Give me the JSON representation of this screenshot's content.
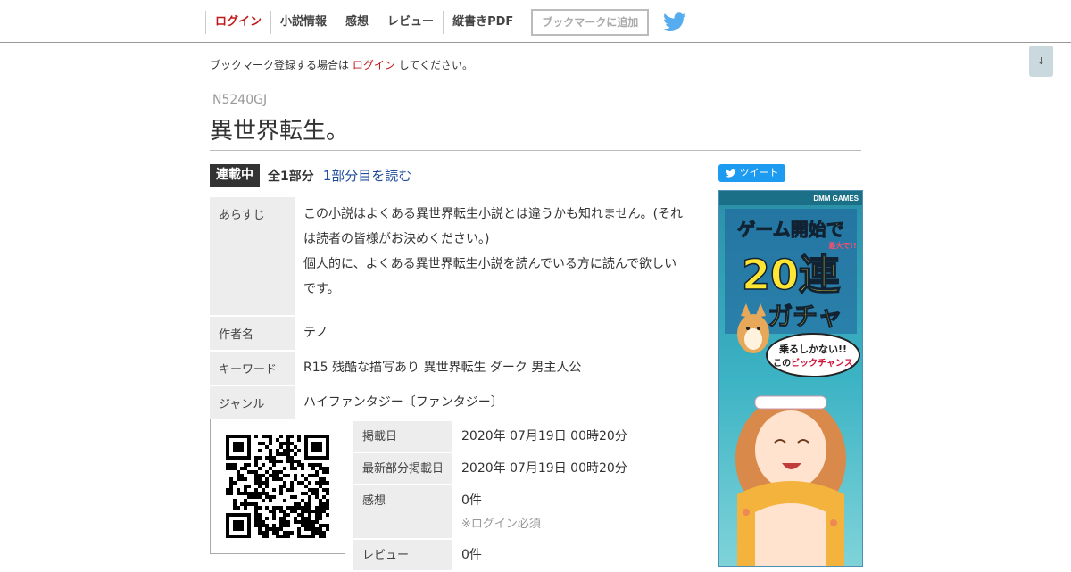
{
  "nav": {
    "items": [
      "ログイン",
      "小説情報",
      "感想",
      "レビュー",
      "縦書きPDF"
    ],
    "bookmark_button": "ブックマークに追加"
  },
  "down_button": "↓",
  "notice": {
    "before": "ブックマーク登録する場合は ",
    "link": "ログイン",
    "after": " してください。"
  },
  "novel": {
    "ncode": "N5240GJ",
    "title": "異世界転生。",
    "status_badge": "連載中",
    "parts": "全1部分",
    "read_link": "1部分目を読む"
  },
  "info": {
    "synopsis_label": "あらすじ",
    "synopsis_line1": "この小説はよくある異世界転生小説とは違うかも知れません。(それは読者の皆様がお決めください。)",
    "synopsis_line2": "個人的に、よくある異世界転生小説を読んでいる方に読んで欲しいです。",
    "author_label": "作者名",
    "author": "テノ",
    "keywords_label": "キーワード",
    "keywords": "R15 残酷な描写あり 異世界転生 ダーク 男主人公",
    "genre_label": "ジャンル",
    "genre": "ハイファンタジー〔ファンタジー〕"
  },
  "details": {
    "posted_label": "掲載日",
    "posted": "2020年 07月19日 00時20分",
    "latest_label": "最新部分掲載日",
    "latest": "2020年 07月19日 00時20分",
    "impressions_label": "感想",
    "impressions": "0件",
    "login_required": "※ログイン必須",
    "reviews_label": "レビュー",
    "reviews": "0件"
  },
  "tweet_button": "ツイート",
  "ad": {
    "brand": "DMM GAMES",
    "line1": "ゲーム開始で",
    "max": "最大で!!",
    "line2": "20連",
    "line3": "ガチャ",
    "bubble1": "乗るしかない!!",
    "bubble2a": "この",
    "bubble2b": "ビックチャンス"
  },
  "colors": {
    "accent_red": "#c0191b",
    "link_blue": "#1f4e9c",
    "twitter_blue": "#1d9bf0",
    "label_bg": "#ededed"
  }
}
